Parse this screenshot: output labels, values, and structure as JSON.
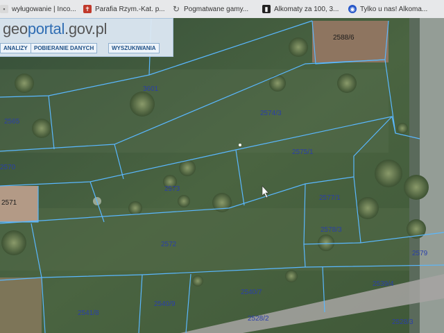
{
  "browser": {
    "tabs": [
      {
        "label": "wyługowanie | Inco...",
        "icon": "document-icon"
      },
      {
        "label": "Parafia Rzym.-Kat. p...",
        "icon": "church-icon"
      },
      {
        "label": "Pogmatwane gamy...",
        "icon": "reload-icon"
      },
      {
        "label": "Alkomaty za 100, 3...",
        "icon": "bookmark-icon"
      },
      {
        "label": "Tylko u nas! Alkoma...",
        "icon": "globe-icon"
      }
    ]
  },
  "site": {
    "logo_prefix": "geo",
    "logo_brand": "portal",
    "logo_suffix": ".gov.pl"
  },
  "toolbar": {
    "analyses_label": "ANALIZY",
    "download_label": "POBIERANIE DANYCH",
    "search_label": "WYSZUKIWANIA"
  },
  "parcels": {
    "p2588_6": "2588/6",
    "p3601": "3601",
    "p2574_3": "2574/3",
    "p2575_1": "2575/1",
    "p2565": "2565",
    "p2570": "2570",
    "p2573": "2573",
    "p2577_1": "2577/1",
    "p2571": "2571",
    "p2578_3": "2578/3",
    "p2572": "2572",
    "p2579": "2579",
    "p2540_7": "2540/7",
    "p2539_4": "2539/4",
    "p2541_8": "2541/8",
    "p2540_9": "2540/9",
    "p2528_2": "2528/2",
    "p2528_3": "2528/3"
  },
  "colors": {
    "boundary": "#5ab8ff",
    "label": "#2a3fa8"
  }
}
